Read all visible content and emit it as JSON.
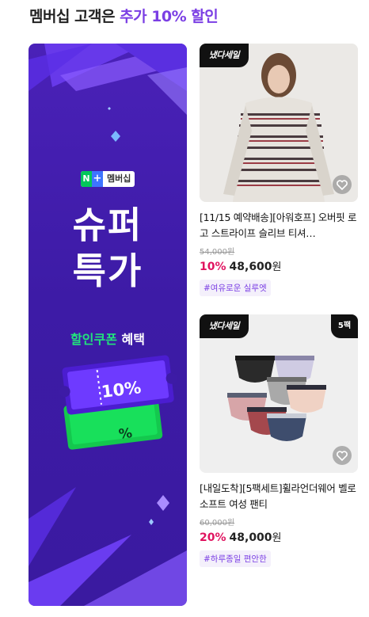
{
  "section": {
    "title_prefix": "멤버십 고객은",
    "title_highlight": "추가 10% 할인"
  },
  "banner": {
    "n_badge": "N",
    "plus_badge": "+",
    "membership_label": "멤버십",
    "headline_line1": "슈퍼",
    "headline_line2": "특가",
    "coupon_highlight": "할인쿠폰",
    "coupon_suffix": "혜택",
    "coupon_value": "10%",
    "coupon_back_value": "%"
  },
  "products": [
    {
      "badge": "냈다세일",
      "title": "[11/15 예약배송][아워호프] 오버핏 로고 스트라이프 슬리브 티셔…",
      "original_price": "54,000원",
      "discount_pct": "10%",
      "price": "48,600",
      "currency": "원",
      "tag": "#여유로운 실루엣",
      "icon": "heart-icon"
    },
    {
      "badge": "냈다세일",
      "pack_badge": "5팩",
      "title": "[내일도착][5팩세트]휠라언더웨어 벨로 소프트 여성 팬티",
      "original_price": "60,000원",
      "discount_pct": "20%",
      "price": "48,000",
      "currency": "원",
      "tag": "#하루종일 편안한",
      "icon": "heart-icon"
    }
  ],
  "colors": {
    "accent": "#7b3fe4",
    "banner_bg": "#3d1ba6",
    "discount": "#e0135f",
    "coupon_green": "#22e27c"
  }
}
